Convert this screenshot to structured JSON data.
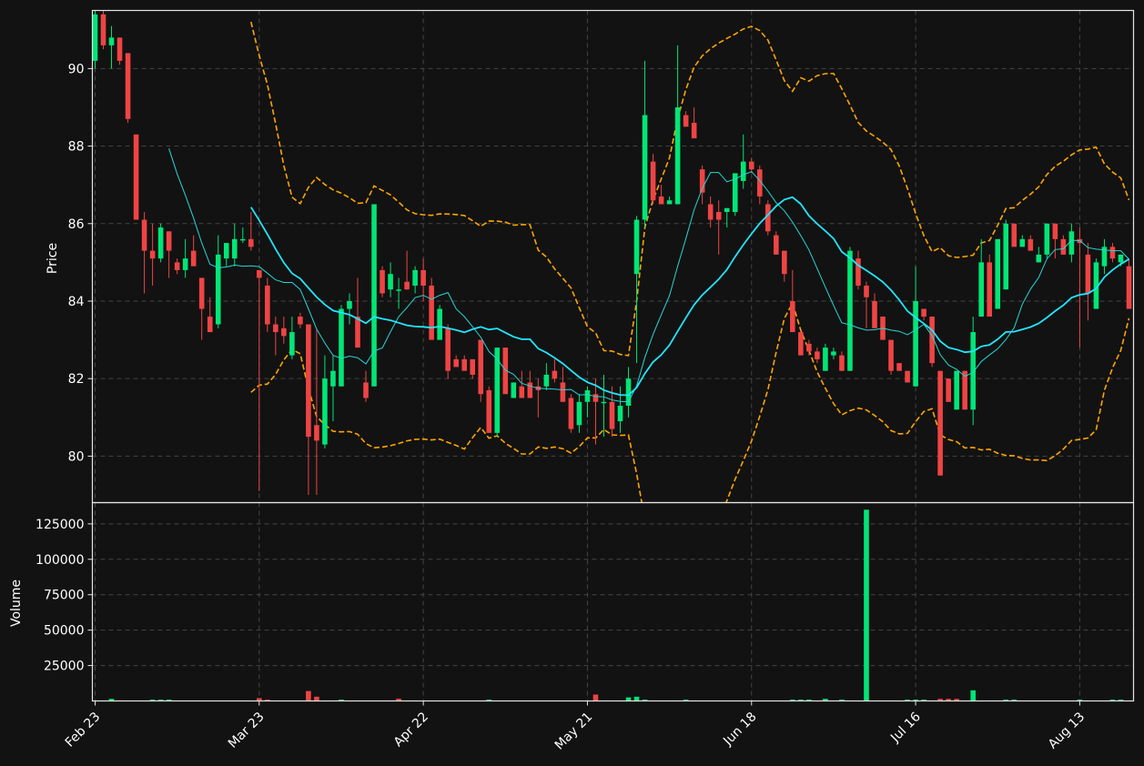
{
  "colors": {
    "background": "#121212",
    "up": "#00e676",
    "down": "#ef4444",
    "ma_fast": "#26d7d7",
    "ma_slow": "#22e5ff",
    "bands": "#ffa500",
    "grid": "#444444",
    "text": "#ffffff"
  },
  "chart_data": {
    "type": "candlestick",
    "panels": [
      "price",
      "volume"
    ],
    "ylabel_price": "Price",
    "ylabel_volume": "Volume",
    "ylim_price": [
      78.8,
      91.5
    ],
    "ylim_volume": [
      0,
      140000
    ],
    "price_ticks": [
      80,
      82,
      84,
      86,
      88,
      90
    ],
    "volume_ticks": [
      25000,
      50000,
      75000,
      100000,
      125000
    ],
    "x_tick_labels": [
      {
        "label": "Feb 23",
        "index": 0
      },
      {
        "label": "Mar 23",
        "index": 20
      },
      {
        "label": "Apr 22",
        "index": 40
      },
      {
        "label": "May 21",
        "index": 60
      },
      {
        "label": "Jun 18",
        "index": 80
      },
      {
        "label": "Jul 16",
        "index": 100
      },
      {
        "label": "Aug 13",
        "index": 120
      }
    ],
    "grid": true,
    "ohlc": [
      [
        90.2,
        91.5,
        90.0,
        91.4
      ],
      [
        91.4,
        91.5,
        90.5,
        90.6
      ],
      [
        90.6,
        91.1,
        90.0,
        90.8
      ],
      [
        90.8,
        90.8,
        90.1,
        90.2
      ],
      [
        90.4,
        90.4,
        88.6,
        88.7
      ],
      [
        88.3,
        88.3,
        86.1,
        86.1
      ],
      [
        86.1,
        86.3,
        84.2,
        85.3
      ],
      [
        85.3,
        86.0,
        84.4,
        85.1
      ],
      [
        85.1,
        86.0,
        85.0,
        85.9
      ],
      [
        85.8,
        85.8,
        84.6,
        85.3
      ],
      [
        85.0,
        85.1,
        84.7,
        84.8
      ],
      [
        84.8,
        85.6,
        84.6,
        85.1
      ],
      [
        85.3,
        85.7,
        84.9,
        84.9
      ],
      [
        84.6,
        84.6,
        83.0,
        83.8
      ],
      [
        83.6,
        84.1,
        83.2,
        83.2
      ],
      [
        83.4,
        85.7,
        83.3,
        85.2
      ],
      [
        85.1,
        85.5,
        84.9,
        85.5
      ],
      [
        85.1,
        86.0,
        84.9,
        85.6
      ],
      [
        85.6,
        85.9,
        85.5,
        85.6
      ],
      [
        85.6,
        86.3,
        85.3,
        85.4
      ],
      [
        84.8,
        84.8,
        79.1,
        84.6
      ],
      [
        84.4,
        84.6,
        83.2,
        83.4
      ],
      [
        83.4,
        83.6,
        82.6,
        83.2
      ],
      [
        83.3,
        83.6,
        82.9,
        83.1
      ],
      [
        82.6,
        83.6,
        82.5,
        83.2
      ],
      [
        83.6,
        83.7,
        83.3,
        83.4
      ],
      [
        83.4,
        83.4,
        79.0,
        80.5
      ],
      [
        80.8,
        83.3,
        79.0,
        80.4
      ],
      [
        80.3,
        82.6,
        80.2,
        82.0
      ],
      [
        81.8,
        82.6,
        80.9,
        82.2
      ],
      [
        81.8,
        83.9,
        81.8,
        83.8
      ],
      [
        83.8,
        84.2,
        83.4,
        84.0
      ],
      [
        83.6,
        84.6,
        83.2,
        82.8
      ],
      [
        81.9,
        82.2,
        81.4,
        81.5
      ],
      [
        81.8,
        86.5,
        81.8,
        86.5
      ],
      [
        84.8,
        84.9,
        84.1,
        84.2
      ],
      [
        84.3,
        85.0,
        84.1,
        84.7
      ],
      [
        84.3,
        84.6,
        83.8,
        84.3
      ],
      [
        84.5,
        85.3,
        84.3,
        84.3
      ],
      [
        84.4,
        84.9,
        84.2,
        84.8
      ],
      [
        84.8,
        85.1,
        84.0,
        84.4
      ],
      [
        84.4,
        84.6,
        83.1,
        83.0
      ],
      [
        83.0,
        83.9,
        83.0,
        83.8
      ],
      [
        83.3,
        83.4,
        82.0,
        82.2
      ],
      [
        82.5,
        82.6,
        82.3,
        82.3
      ],
      [
        82.5,
        82.6,
        82.3,
        82.2
      ],
      [
        82.5,
        82.5,
        82.0,
        82.1
      ],
      [
        83.0,
        83.0,
        81.4,
        81.6
      ],
      [
        81.7,
        81.8,
        80.6,
        80.6
      ],
      [
        80.6,
        82.8,
        80.5,
        82.8
      ],
      [
        82.8,
        82.8,
        81.8,
        81.6
      ],
      [
        81.5,
        81.9,
        81.6,
        81.9
      ],
      [
        81.8,
        82.2,
        81.5,
        81.5
      ],
      [
        81.9,
        82.2,
        81.5,
        81.5
      ],
      [
        81.8,
        82.0,
        81.0,
        81.7
      ],
      [
        81.8,
        82.4,
        81.7,
        82.1
      ],
      [
        82.2,
        82.5,
        81.9,
        82.0
      ],
      [
        81.9,
        82.3,
        81.6,
        81.4
      ],
      [
        81.5,
        81.6,
        80.6,
        80.7
      ],
      [
        80.8,
        81.6,
        80.6,
        81.4
      ],
      [
        81.4,
        81.8,
        81.0,
        81.7
      ],
      [
        81.6,
        82.0,
        80.3,
        81.4
      ],
      [
        81.4,
        82.1,
        80.5,
        81.4
      ],
      [
        81.4,
        81.8,
        80.5,
        80.7
      ],
      [
        80.9,
        81.8,
        80.6,
        81.3
      ],
      [
        81.3,
        82.3,
        81.0,
        82.0
      ],
      [
        84.7,
        86.2,
        82.4,
        86.1
      ],
      [
        86.1,
        90.2,
        85.9,
        88.8
      ],
      [
        87.6,
        87.8,
        86.5,
        86.6
      ],
      [
        86.7,
        87.0,
        86.5,
        86.5
      ],
      [
        86.5,
        86.7,
        86.5,
        86.6
      ],
      [
        86.5,
        90.6,
        86.5,
        89.0
      ],
      [
        88.8,
        88.9,
        88.5,
        88.5
      ],
      [
        88.6,
        89.0,
        88.4,
        88.2
      ],
      [
        87.4,
        87.5,
        86.5,
        86.8
      ],
      [
        86.5,
        86.7,
        85.9,
        86.1
      ],
      [
        86.3,
        86.6,
        85.2,
        86.1
      ],
      [
        86.3,
        86.4,
        85.9,
        86.4
      ],
      [
        86.3,
        87.2,
        86.2,
        87.3
      ],
      [
        87.1,
        88.3,
        86.9,
        87.6
      ],
      [
        87.6,
        87.7,
        87.3,
        87.4
      ],
      [
        87.4,
        87.5,
        86.5,
        86.7
      ],
      [
        86.5,
        86.6,
        85.7,
        85.8
      ],
      [
        85.7,
        85.8,
        85.2,
        85.2
      ],
      [
        85.3,
        85.3,
        84.5,
        84.7
      ],
      [
        84.0,
        84.8,
        83.3,
        83.2
      ],
      [
        83.2,
        83.2,
        82.6,
        82.6
      ],
      [
        82.9,
        83.0,
        82.6,
        82.7
      ],
      [
        82.7,
        82.8,
        82.4,
        82.5
      ],
      [
        82.2,
        82.9,
        82.2,
        82.8
      ],
      [
        82.6,
        82.8,
        82.5,
        82.7
      ],
      [
        82.6,
        82.7,
        82.2,
        82.2
      ],
      [
        82.2,
        85.4,
        82.2,
        85.3
      ],
      [
        85.1,
        85.3,
        84.3,
        84.4
      ],
      [
        84.4,
        84.5,
        83.3,
        84.1
      ],
      [
        84.0,
        84.2,
        83.3,
        83.3
      ],
      [
        83.6,
        83.6,
        83.0,
        83.0
      ],
      [
        83.0,
        83.0,
        82.1,
        82.2
      ],
      [
        82.4,
        82.4,
        82.2,
        82.2
      ],
      [
        82.2,
        82.2,
        81.9,
        81.9
      ],
      [
        81.8,
        84.9,
        81.8,
        84.0
      ],
      [
        83.8,
        83.8,
        83.5,
        83.6
      ],
      [
        83.6,
        83.6,
        82.3,
        82.4
      ],
      [
        82.2,
        82.2,
        79.5,
        79.5
      ],
      [
        82.0,
        82.0,
        81.4,
        81.4
      ],
      [
        81.2,
        82.2,
        81.2,
        82.2
      ],
      [
        82.2,
        82.2,
        81.4,
        81.2
      ],
      [
        81.2,
        83.6,
        80.8,
        83.2
      ],
      [
        83.6,
        85.6,
        83.6,
        85.0
      ],
      [
        85.0,
        85.2,
        83.6,
        83.6
      ],
      [
        83.8,
        85.6,
        83.8,
        85.6
      ],
      [
        84.3,
        86.1,
        84.3,
        86.0
      ],
      [
        86.0,
        86.0,
        85.4,
        85.4
      ],
      [
        85.4,
        85.7,
        85.4,
        85.6
      ],
      [
        85.6,
        85.7,
        85.3,
        85.3
      ],
      [
        85.0,
        85.4,
        85.0,
        85.2
      ],
      [
        85.2,
        86.0,
        85.1,
        86.0
      ],
      [
        86.0,
        86.0,
        85.1,
        85.6
      ],
      [
        85.6,
        85.7,
        85.2,
        85.2
      ],
      [
        85.2,
        86.0,
        85.0,
        85.8
      ],
      [
        85.6,
        85.9,
        82.8,
        85.5
      ],
      [
        85.2,
        85.5,
        83.5,
        84.2
      ],
      [
        83.8,
        85.1,
        83.8,
        85.0
      ],
      [
        84.9,
        85.6,
        84.7,
        85.4
      ],
      [
        85.4,
        85.5,
        85.0,
        85.1
      ],
      [
        85.0,
        85.2,
        84.9,
        85.2
      ],
      [
        84.9,
        85.1,
        83.8,
        83.8
      ]
    ],
    "volume": [
      0,
      0,
      1500,
      0,
      0,
      0,
      0,
      600,
      0,
      0,
      600,
      600,
      0,
      0,
      0,
      0,
      0,
      0,
      0,
      0,
      2000,
      600,
      0,
      0,
      0,
      0,
      7000,
      3000,
      0,
      0,
      800,
      0,
      0,
      0,
      0,
      0,
      0,
      0,
      1600,
      0,
      0,
      0,
      0,
      0,
      0,
      0,
      0,
      0,
      500,
      0,
      0,
      0,
      0,
      0,
      0,
      0,
      0,
      300,
      0,
      0,
      0,
      4500,
      0,
      0,
      0,
      0,
      2500,
      3000,
      500,
      0,
      0,
      0,
      0,
      0,
      0,
      400,
      0,
      0,
      0,
      0,
      0,
      0,
      0,
      0,
      0,
      500,
      500,
      500,
      0,
      0,
      1500,
      0,
      600,
      0,
      0,
      0,
      135000,
      0,
      0,
      0,
      0,
      0,
      0,
      500,
      400,
      500,
      0,
      0,
      0,
      1500,
      1500,
      1500,
      0,
      0,
      7500,
      0,
      0,
      0,
      500,
      0,
      0,
      0,
      0,
      0,
      0,
      0,
      0,
      0,
      0,
      0,
      0,
      0,
      0,
      0,
      0,
      0,
      0,
      0,
      0,
      0,
      0,
      0,
      0,
      0,
      0,
      0,
      0,
      0,
      0,
      0,
      0,
      0,
      0,
      0,
      0,
      0,
      0,
      0,
      0,
      0,
      0,
      0,
      0,
      0,
      0,
      0,
      0,
      0,
      0,
      0,
      0,
      0,
      0,
      0,
      0,
      0,
      0,
      0,
      0,
      0,
      0,
      0,
      0,
      0,
      0,
      0,
      0,
      0,
      0,
      0,
      0,
      0,
      0,
      0,
      0,
      0,
      0,
      0,
      0,
      0,
      0,
      0,
      0,
      0,
      0,
      0,
      0,
      0,
      0,
      0,
      0,
      0,
      0,
      0,
      0,
      0,
      0,
      0,
      0,
      0,
      0,
      0,
      0,
      0,
      0,
      0,
      0,
      0,
      0,
      0,
      0,
      0,
      0,
      0,
      0,
      0,
      0,
      0,
      0,
      0,
      0,
      0,
      0,
      0,
      0,
      0,
      0,
      0,
      0,
      0,
      0,
      0,
      0,
      0,
      0,
      0,
      0,
      0,
      0,
      0,
      0,
      0,
      0,
      0,
      0,
      0,
      0,
      0,
      0,
      0,
      0,
      0,
      0,
      0,
      0,
      0,
      0,
      0,
      0,
      0,
      0,
      0,
      0,
      0,
      0,
      0,
      0,
      0,
      0,
      0,
      0,
      0,
      0,
      0,
      0,
      0,
      0,
      0,
      0,
      0,
      0,
      0,
      0,
      0,
      0,
      0,
      0,
      0,
      0,
      0,
      0,
      0,
      0,
      0,
      0,
      0,
      0,
      0,
      0,
      0,
      0,
      0,
      0,
      0,
      0,
      0,
      0,
      0,
      0,
      0
    ],
    "volume_bars": [
      {
        "index": 2,
        "value": 1500,
        "color": "up"
      },
      {
        "index": 7,
        "value": 600,
        "color": "up"
      },
      {
        "index": 8,
        "value": 600,
        "color": "up"
      },
      {
        "index": 9,
        "value": 600,
        "color": "up"
      },
      {
        "index": 20,
        "value": 2000,
        "color": "down"
      },
      {
        "index": 21,
        "value": 600,
        "color": "down"
      },
      {
        "index": 26,
        "value": 7000,
        "color": "down"
      },
      {
        "index": 27,
        "value": 3000,
        "color": "down"
      },
      {
        "index": 30,
        "value": 800,
        "color": "up"
      },
      {
        "index": 37,
        "value": 1600,
        "color": "down"
      },
      {
        "index": 48,
        "value": 500,
        "color": "up"
      },
      {
        "index": 61,
        "value": 4500,
        "color": "down"
      },
      {
        "index": 65,
        "value": 2500,
        "color": "up"
      },
      {
        "index": 66,
        "value": 3000,
        "color": "up"
      },
      {
        "index": 67,
        "value": 500,
        "color": "up"
      },
      {
        "index": 72,
        "value": 400,
        "color": "up"
      },
      {
        "index": 85,
        "value": 500,
        "color": "up"
      },
      {
        "index": 86,
        "value": 500,
        "color": "up"
      },
      {
        "index": 87,
        "value": 500,
        "color": "up"
      },
      {
        "index": 89,
        "value": 1500,
        "color": "up"
      },
      {
        "index": 91,
        "value": 600,
        "color": "up"
      },
      {
        "index": 94,
        "value": 135000,
        "color": "up"
      },
      {
        "index": 99,
        "value": 500,
        "color": "up"
      },
      {
        "index": 100,
        "value": 400,
        "color": "up"
      },
      {
        "index": 101,
        "value": 500,
        "color": "up"
      },
      {
        "index": 103,
        "value": 1500,
        "color": "down"
      },
      {
        "index": 104,
        "value": 1500,
        "color": "down"
      },
      {
        "index": 105,
        "value": 1500,
        "color": "down"
      },
      {
        "index": 107,
        "value": 7500,
        "color": "up"
      },
      {
        "index": 111,
        "value": 500,
        "color": "up"
      },
      {
        "index": 112,
        "value": 500,
        "color": "up"
      },
      {
        "index": 120,
        "value": 500,
        "color": "up"
      },
      {
        "index": 124,
        "value": 500,
        "color": "up"
      },
      {
        "index": 125,
        "value": 500,
        "color": "up"
      }
    ]
  }
}
